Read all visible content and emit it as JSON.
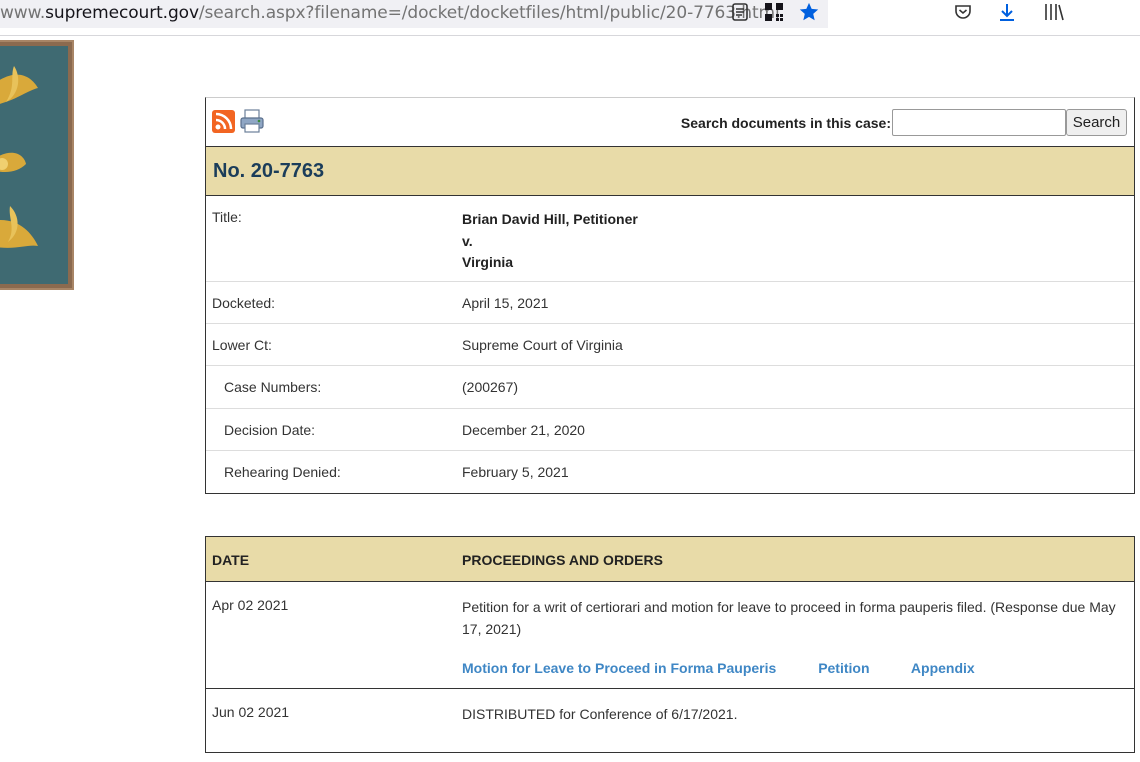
{
  "browser": {
    "url_prefix": "www.",
    "url_host": "supremecourt.gov",
    "url_path": "/search.aspx?filename=/docket/docketfiles/html/public/20-7763.html",
    "toolbar_icons": [
      "reader-view-icon",
      "qr-code-icon",
      "bookmark-star-icon",
      "pocket-icon",
      "download-icon",
      "library-icon"
    ]
  },
  "tools": {
    "rss_icon": "rss-feed-icon",
    "print_icon": "printer-icon",
    "search_label": "Search documents in this case:",
    "search_value": "",
    "search_button": "Search"
  },
  "case": {
    "number": "No. 20-7763",
    "title_label": "Title:",
    "title_lines": [
      "Brian David Hill, Petitioner",
      "v.",
      "Virginia"
    ],
    "docketed_label": "Docketed:",
    "docketed": "April 15, 2021",
    "lower_ct_label": "Lower Ct:",
    "lower_ct": "Supreme Court of Virginia",
    "case_numbers_label": "Case Numbers:",
    "case_numbers": "(200267)",
    "decision_date_label": "Decision Date:",
    "decision_date": "December 21, 2020",
    "rehearing_denied_label": "Rehearing Denied:",
    "rehearing_denied": "February 5, 2021"
  },
  "proceedings": {
    "date_header": "DATE",
    "orders_header": "PROCEEDINGS AND ORDERS",
    "entries": [
      {
        "date": "Apr 02 2021",
        "text": "Petition for a writ of certiorari and motion for leave to proceed in forma pauperis filed. (Response due May 17, 2021)",
        "links": [
          "Motion for Leave to Proceed in Forma Pauperis",
          "Petition",
          "Appendix"
        ]
      },
      {
        "date": "Jun 02 2021",
        "text": "DISTRIBUTED for Conference of 6/17/2021."
      }
    ]
  },
  "colors": {
    "header_bg": "#e8dba8",
    "case_number": "#1b3d5a",
    "link": "#3f87c5",
    "rss": "#f26522"
  }
}
